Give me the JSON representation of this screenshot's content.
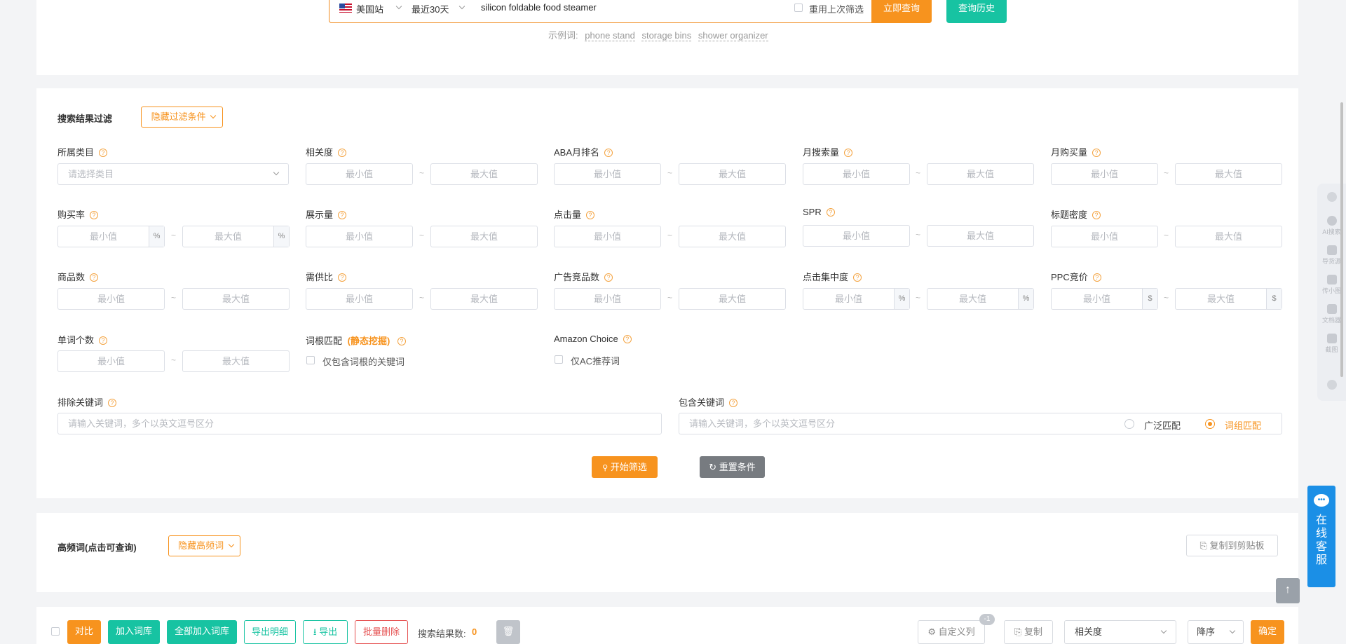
{
  "search": {
    "site_label": "美国站",
    "period_label": "最近30天",
    "query": "silicon foldable food steamer",
    "reuse_label": "重用上次筛选",
    "submit_label": "立即查询",
    "history_label": "查询历史",
    "examples_prefix": "示例词:",
    "examples": [
      "phone stand",
      "storage bins",
      "shower organizer"
    ]
  },
  "filters": {
    "title": "搜索结果过滤",
    "hide_label": "隐藏过滤条件",
    "min_placeholder": "最小值",
    "max_placeholder": "最大值",
    "category_placeholder": "请选择类目",
    "percent": "%",
    "dollar": "$",
    "fields": {
      "category": "所属类目",
      "relevance": "相关度",
      "aba_rank": "ABA月排名",
      "monthly_search": "月搜索量",
      "monthly_purchase": "月购买量",
      "purchase_rate": "购买率",
      "impressions": "展示量",
      "clicks": "点击量",
      "spr": "SPR",
      "title_density": "标题密度",
      "product_count": "商品数",
      "supply_demand": "需供比",
      "ad_products": "广告竞品数",
      "click_concentration": "点击集中度",
      "ppc_bid": "PPC竞价",
      "word_count": "单词个数",
      "root_match": "词根匹配",
      "root_match_tag": "(静态挖掘)",
      "root_match_option": "仅包含词根的关键词",
      "amazon_choice": "Amazon Choice",
      "ac_option": "仅AC推荐词",
      "exclude_keywords": "排除关键词",
      "include_keywords": "包含关键词",
      "keyword_placeholder": "请输入关键词，多个以英文逗号区分",
      "broad_match": "广泛匹配",
      "phrase_match": "词组匹配"
    },
    "start_label": "开始筛选",
    "reset_label": "重置条件"
  },
  "frequent": {
    "title": "高频词(点击可查询)",
    "hide_label": "隐藏高频词",
    "copy_label": "复制到剪贴板"
  },
  "toolbar": {
    "compare": "对比",
    "add_to_lib": "加入词库",
    "add_all_to_lib": "全部加入词库",
    "export_detail": "导出明细",
    "export": "导出",
    "batch_delete": "批量删除",
    "result_count_label": "搜索结果数:",
    "result_count": "0",
    "custom_columns": "自定义列",
    "custom_badge": "-1",
    "copy": "复制",
    "sort_field": "相关度",
    "sort_order": "降序",
    "confirm": "确定"
  },
  "side": {
    "items": [
      "AI搜索",
      "导货源",
      "传小图",
      "文档器",
      "截图"
    ]
  },
  "chat": {
    "label": "在线客服"
  },
  "colors": {
    "accent": "#f7931e",
    "teal": "#17c3a2",
    "chat_blue": "#1b8fe6"
  }
}
